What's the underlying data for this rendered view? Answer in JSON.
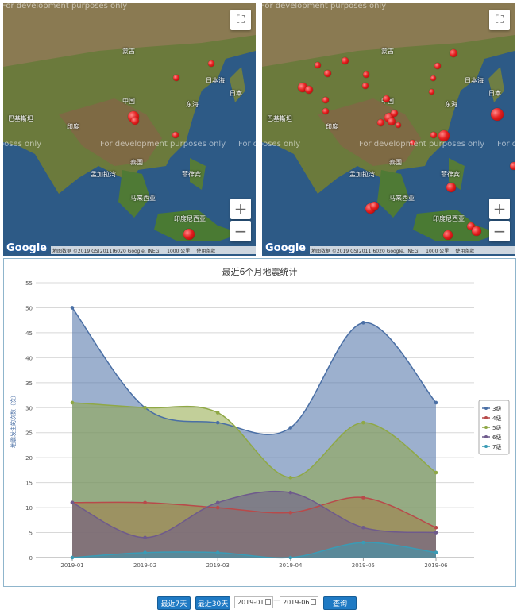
{
  "maps": {
    "dev_overlay": "For development purposes only",
    "attribution": "地图数据 ©2019 GS(2011)6020 Google, INEGI",
    "scale": "1000 公里",
    "terms": "使用条款",
    "logo": "Google",
    "fullscreen_icon": "fullscreen-icon",
    "zoom_in": "+",
    "zoom_out": "−",
    "place_labels": [
      "蒙古",
      "日本海",
      "中国",
      "东海",
      "巴基斯坦",
      "印度",
      "孟加拉湾",
      "泰国",
      "菲律宾",
      "马来西亚",
      "印度尼西亚",
      "日本"
    ]
  },
  "chart_data": {
    "type": "area",
    "title": "最近6个月地震统计",
    "ylabel": "地震发生的次数（次）",
    "xlabel": "",
    "categories": [
      "2019-01",
      "2019-02",
      "2019-03",
      "2019-04",
      "2019-05",
      "2019-06"
    ],
    "ylim": [
      0,
      55
    ],
    "yticks": [
      0,
      5,
      10,
      15,
      20,
      25,
      30,
      35,
      40,
      45,
      50,
      55
    ],
    "grid": true,
    "legend_position": "right",
    "series": [
      {
        "name": "3级",
        "values": [
          50,
          30,
          27,
          26,
          47,
          31
        ],
        "color": "#4a6fa5",
        "marker": "circle"
      },
      {
        "name": "4级",
        "values": [
          11,
          11,
          10,
          9,
          12,
          6
        ],
        "color": "#b84a4a",
        "marker": "diamond"
      },
      {
        "name": "5级",
        "values": [
          31,
          30,
          29,
          16,
          27,
          17
        ],
        "color": "#8fa846",
        "marker": "square"
      },
      {
        "name": "6级",
        "values": [
          11,
          4,
          11,
          13,
          6,
          5
        ],
        "color": "#6e5a8c",
        "marker": "triangle"
      },
      {
        "name": "7级",
        "values": [
          0,
          1,
          1,
          0,
          3,
          1
        ],
        "color": "#3a9bb5",
        "marker": "triangle-down"
      }
    ]
  },
  "toolbar": {
    "last7_label": "最近7天",
    "last30_label": "最近30天",
    "start_date": "2019-01",
    "end_date": "2019-06",
    "separator": "—",
    "query_label": "查询"
  }
}
